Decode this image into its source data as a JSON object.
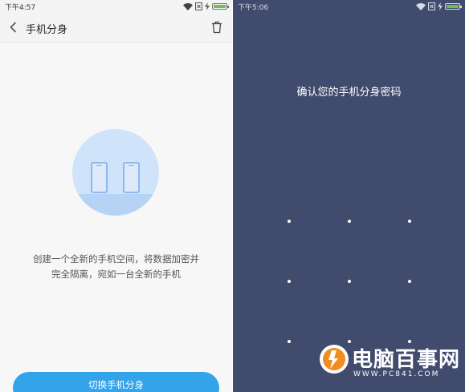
{
  "colors": {
    "left_bg": "#f7f7f7",
    "accent_button": "#33a3ea",
    "battery_green": "#6dc24b",
    "right_bg": "#414b6d",
    "watermark_orange": "#f28c1e"
  },
  "left": {
    "status": {
      "time": "下午4:57",
      "icons": [
        "wifi-icon",
        "sim-card-icon",
        "charging-bolt-icon",
        "battery-icon"
      ],
      "battery_level": 1.0
    },
    "title": "手机分身",
    "icons": {
      "back": "chevron-left-icon",
      "delete": "trash-icon"
    },
    "illustration": "two-phones-illustration",
    "description": [
      "创建一个全新的手机空间，将数据加密并",
      "完全隔离，宛如一台全新的手机"
    ],
    "button_label": "切换手机分身"
  },
  "right": {
    "status": {
      "time": "下午5:06",
      "icons": [
        "wifi-icon",
        "sim-card-icon",
        "charging-bolt-icon",
        "battery-icon"
      ],
      "battery_level": 1.0
    },
    "prompt": "确认您的手机分身密码",
    "pattern_grid": "3x3 pattern lock dots"
  },
  "watermark": {
    "brand": "电脑百事网",
    "url": "WWW.PC841.COM"
  }
}
